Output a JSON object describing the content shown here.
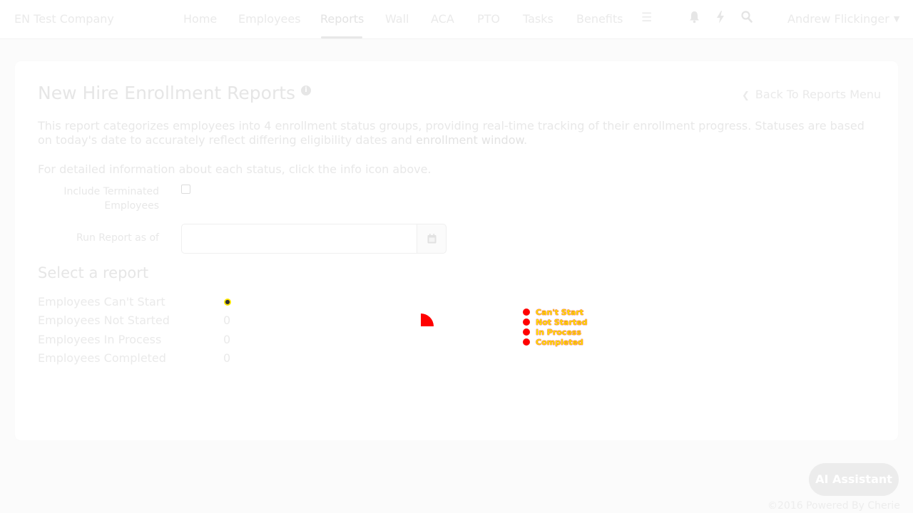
{
  "header": {
    "company": "EN Test Company",
    "nav": [
      {
        "label": "Home",
        "active": false
      },
      {
        "label": "Employees",
        "active": false
      },
      {
        "label": "Reports",
        "active": true
      },
      {
        "label": "Wall",
        "active": false
      },
      {
        "label": "ACA",
        "active": false
      },
      {
        "label": "PTO",
        "active": false
      },
      {
        "label": "Tasks",
        "active": false
      },
      {
        "label": "Benefits",
        "active": false
      }
    ],
    "icons": [
      "menu-icon",
      "bell-icon",
      "bolt-icon",
      "search-icon"
    ],
    "user": "Andrew Flickinger"
  },
  "page": {
    "title": "New Hire Enrollment Reports",
    "back_link": "Back To Reports Menu",
    "description_prefix": "This report categorizes employees into 4 enrollment status groups, providing real-time tracking of their enrollment progress. Statuses are based on today's date to accurately reflect differing eligibility dates and ",
    "description_link": "enrollment window",
    "description_suffix": ".",
    "description2": "For detailed information about each status, click the info icon above."
  },
  "form": {
    "include_terminated_label": "Include Terminated Employees",
    "include_terminated_checked": false,
    "run_report_label": "Run Report as of",
    "run_report_value": ""
  },
  "reports": {
    "title": "Select a report",
    "items": [
      {
        "label": "Employees Can't Start",
        "count": ""
      },
      {
        "label": "Employees Not Started",
        "count": "0"
      },
      {
        "label": "Employees In Process",
        "count": "0"
      },
      {
        "label": "Employees Completed",
        "count": "0"
      }
    ]
  },
  "chart_data": {
    "type": "pie",
    "categories": [
      "Can't Start",
      "Not Started",
      "In Process",
      "Completed"
    ],
    "values": [
      0,
      0,
      0,
      0
    ],
    "colors": [
      "#ff0000",
      "#ff0000",
      "#ff0000",
      "#ff0000"
    ],
    "legend_position": "right"
  },
  "ai_button": "AI Assistant",
  "footer": "©2016 Powered By Cherie"
}
